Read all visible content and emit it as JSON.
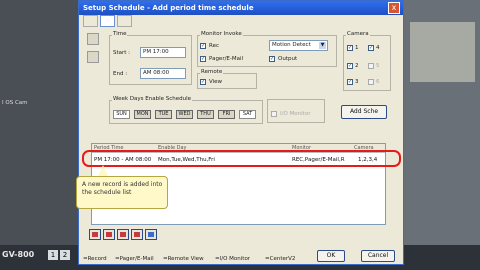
{
  "app": {
    "brand": "GV-800",
    "page_buttons": [
      "1",
      "2"
    ],
    "left_sidebar_text": "I OS Cam"
  },
  "dialog": {
    "title": "Setup Schedule - Add period time schedule",
    "close_label": "x"
  },
  "time": {
    "group_label": "Time",
    "start_label": "Start :",
    "start_value": "PM 17:00",
    "end_label": "End :",
    "end_value": "AM 08:00"
  },
  "monitor_invoke": {
    "group_label": "Monitor Invoke",
    "rec_label": "Rec",
    "rec_checked": true,
    "mode_value": "Motion Detect",
    "pager_label": "Pager/E-Mail",
    "pager_checked": true,
    "output_label": "Output",
    "output_checked": true
  },
  "remote": {
    "group_label": "Remote",
    "view_label": "View",
    "view_checked": true
  },
  "io_monitor": {
    "label": "I/O Monitor",
    "checked": false
  },
  "camera": {
    "group_label": "Camera",
    "items": [
      {
        "label": "1",
        "checked": true
      },
      {
        "label": "4",
        "checked": true
      },
      {
        "label": "2",
        "checked": true
      },
      {
        "label": "5",
        "checked": false
      },
      {
        "label": "3",
        "checked": true
      },
      {
        "label": "6",
        "checked": false
      }
    ]
  },
  "week_days": {
    "group_label": "Week Days Enable Schedule",
    "days": [
      "SUN",
      "MON",
      "TUE",
      "WED",
      "THU",
      "FRI",
      "SAT"
    ],
    "selected": [
      "MON",
      "TUE",
      "WED",
      "THU",
      "FRI"
    ]
  },
  "add_button_label": "Add Sche",
  "schedule_list": {
    "columns": [
      "Period Time",
      "Enable Day",
      "Monitor",
      "Camera"
    ],
    "rows": [
      {
        "period": "PM 17:00 - AM 08:00",
        "days": "Mon,Tue,Wed,Thu,Fri",
        "monitor": "REC,Pager/E-Mail,R",
        "camera": "1,2,3,4"
      }
    ]
  },
  "callout": {
    "text": "A new record is added into the schedule list"
  },
  "buttons": {
    "ok": "OK",
    "cancel": "Cancel"
  },
  "legend": {
    "record": "=Record",
    "pager": "=Pager/E-Mail",
    "remote_view": "=Remote View",
    "io_monitor": "=I/O Monitor",
    "center": "=CenterV2"
  },
  "colors": {
    "titlebar": "#2f6ff0",
    "highlight": "#e61a1a",
    "callout_bg": "#fff8c8"
  }
}
